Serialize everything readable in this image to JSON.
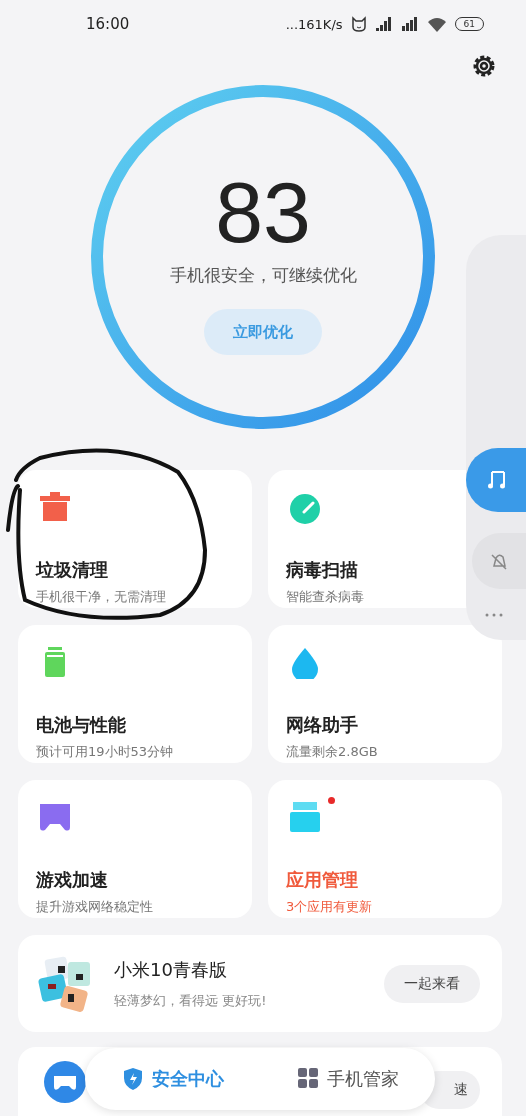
{
  "status_bar": {
    "time": "16:00",
    "network_speed": "...161K/s",
    "battery": "61"
  },
  "score": {
    "value": "83",
    "message": "手机很安全，可继续优化",
    "button": "立即优化"
  },
  "feature_cards": [
    {
      "kind": "trash",
      "title": "垃圾清理",
      "subtitle": "手机很干净，无需清理",
      "alert": false,
      "badge": false
    },
    {
      "kind": "scan",
      "title": "病毒扫描",
      "subtitle": "智能查杀病毒",
      "alert": false,
      "badge": false
    },
    {
      "kind": "battery",
      "title": "电池与性能",
      "subtitle": "预计可用19小时53分钟",
      "alert": false,
      "badge": false
    },
    {
      "kind": "drop",
      "title": "网络助手",
      "subtitle": "流量剩余2.8GB",
      "alert": false,
      "badge": false
    },
    {
      "kind": "game",
      "title": "游戏加速",
      "subtitle": "提升游戏网络稳定性",
      "alert": false,
      "badge": false
    },
    {
      "kind": "box",
      "title": "应用管理",
      "subtitle": "3个应用有更新",
      "alert": true,
      "badge": true
    }
  ],
  "promo": {
    "title": "小米10青春版",
    "subtitle": "轻薄梦幻，看得远 更好玩!",
    "button": "一起来看"
  },
  "promo_2": {
    "button": "速"
  },
  "bottom_nav": [
    {
      "kind": "shield",
      "label": "安全中心",
      "selected": true
    },
    {
      "kind": "grid",
      "label": "手机管家",
      "selected": false
    }
  ]
}
